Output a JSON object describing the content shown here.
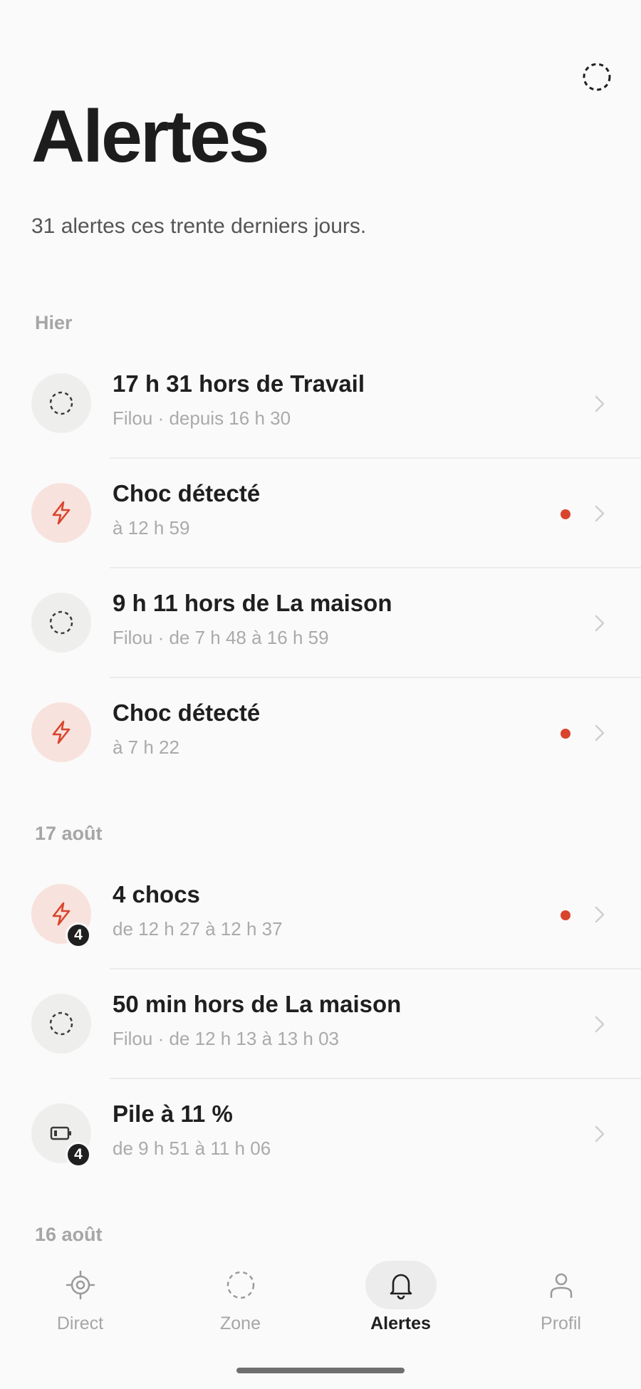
{
  "header": {
    "title": "Alertes",
    "subtitle": "31 alertes ces trente derniers jours.",
    "action_icon": "dashed-circle-icon"
  },
  "sections": [
    {
      "label": "Hier",
      "items": [
        {
          "icon": "zone-icon",
          "tone": "neutral",
          "title": "17 h 31 hors de Travail",
          "sub": "Filou · depuis 16 h 30",
          "unread": false
        },
        {
          "icon": "lightning-icon",
          "tone": "red",
          "title": "Choc détecté",
          "sub": "à 12 h 59",
          "unread": true
        },
        {
          "icon": "zone-icon",
          "tone": "neutral",
          "title": "9 h 11 hors de La maison",
          "sub": "Filou · de 7 h 48 à 16 h 59",
          "unread": false
        },
        {
          "icon": "lightning-icon",
          "tone": "red",
          "title": "Choc détecté",
          "sub": "à 7 h 22",
          "unread": true
        }
      ]
    },
    {
      "label": "17 août",
      "items": [
        {
          "icon": "lightning-icon",
          "tone": "red",
          "title": "4 chocs",
          "sub": "de 12 h 27 à 12 h 37",
          "unread": true,
          "badge": "4"
        },
        {
          "icon": "zone-icon",
          "tone": "neutral",
          "title": "50 min hors de La maison",
          "sub": "Filou · de 12 h 13 à 13 h 03",
          "unread": false
        },
        {
          "icon": "battery-icon",
          "tone": "neutral",
          "title": "Pile à 11 %",
          "sub": "de 9 h 51 à 11 h 06",
          "unread": false,
          "badge": "4"
        }
      ]
    },
    {
      "label": "16 août",
      "items": []
    }
  ],
  "nav": {
    "items": [
      {
        "label": "Direct",
        "icon": "target-icon",
        "active": false
      },
      {
        "label": "Zone",
        "icon": "zone-icon",
        "active": false
      },
      {
        "label": "Alertes",
        "icon": "bell-icon",
        "active": true
      },
      {
        "label": "Profil",
        "icon": "person-icon",
        "active": false
      }
    ]
  },
  "colors": {
    "accent_red": "#d9442c",
    "red_bg": "#f8e2dd",
    "neutral_bg": "#eeeeec",
    "text": "#1f1f1f",
    "muted": "#aaaaaa"
  }
}
